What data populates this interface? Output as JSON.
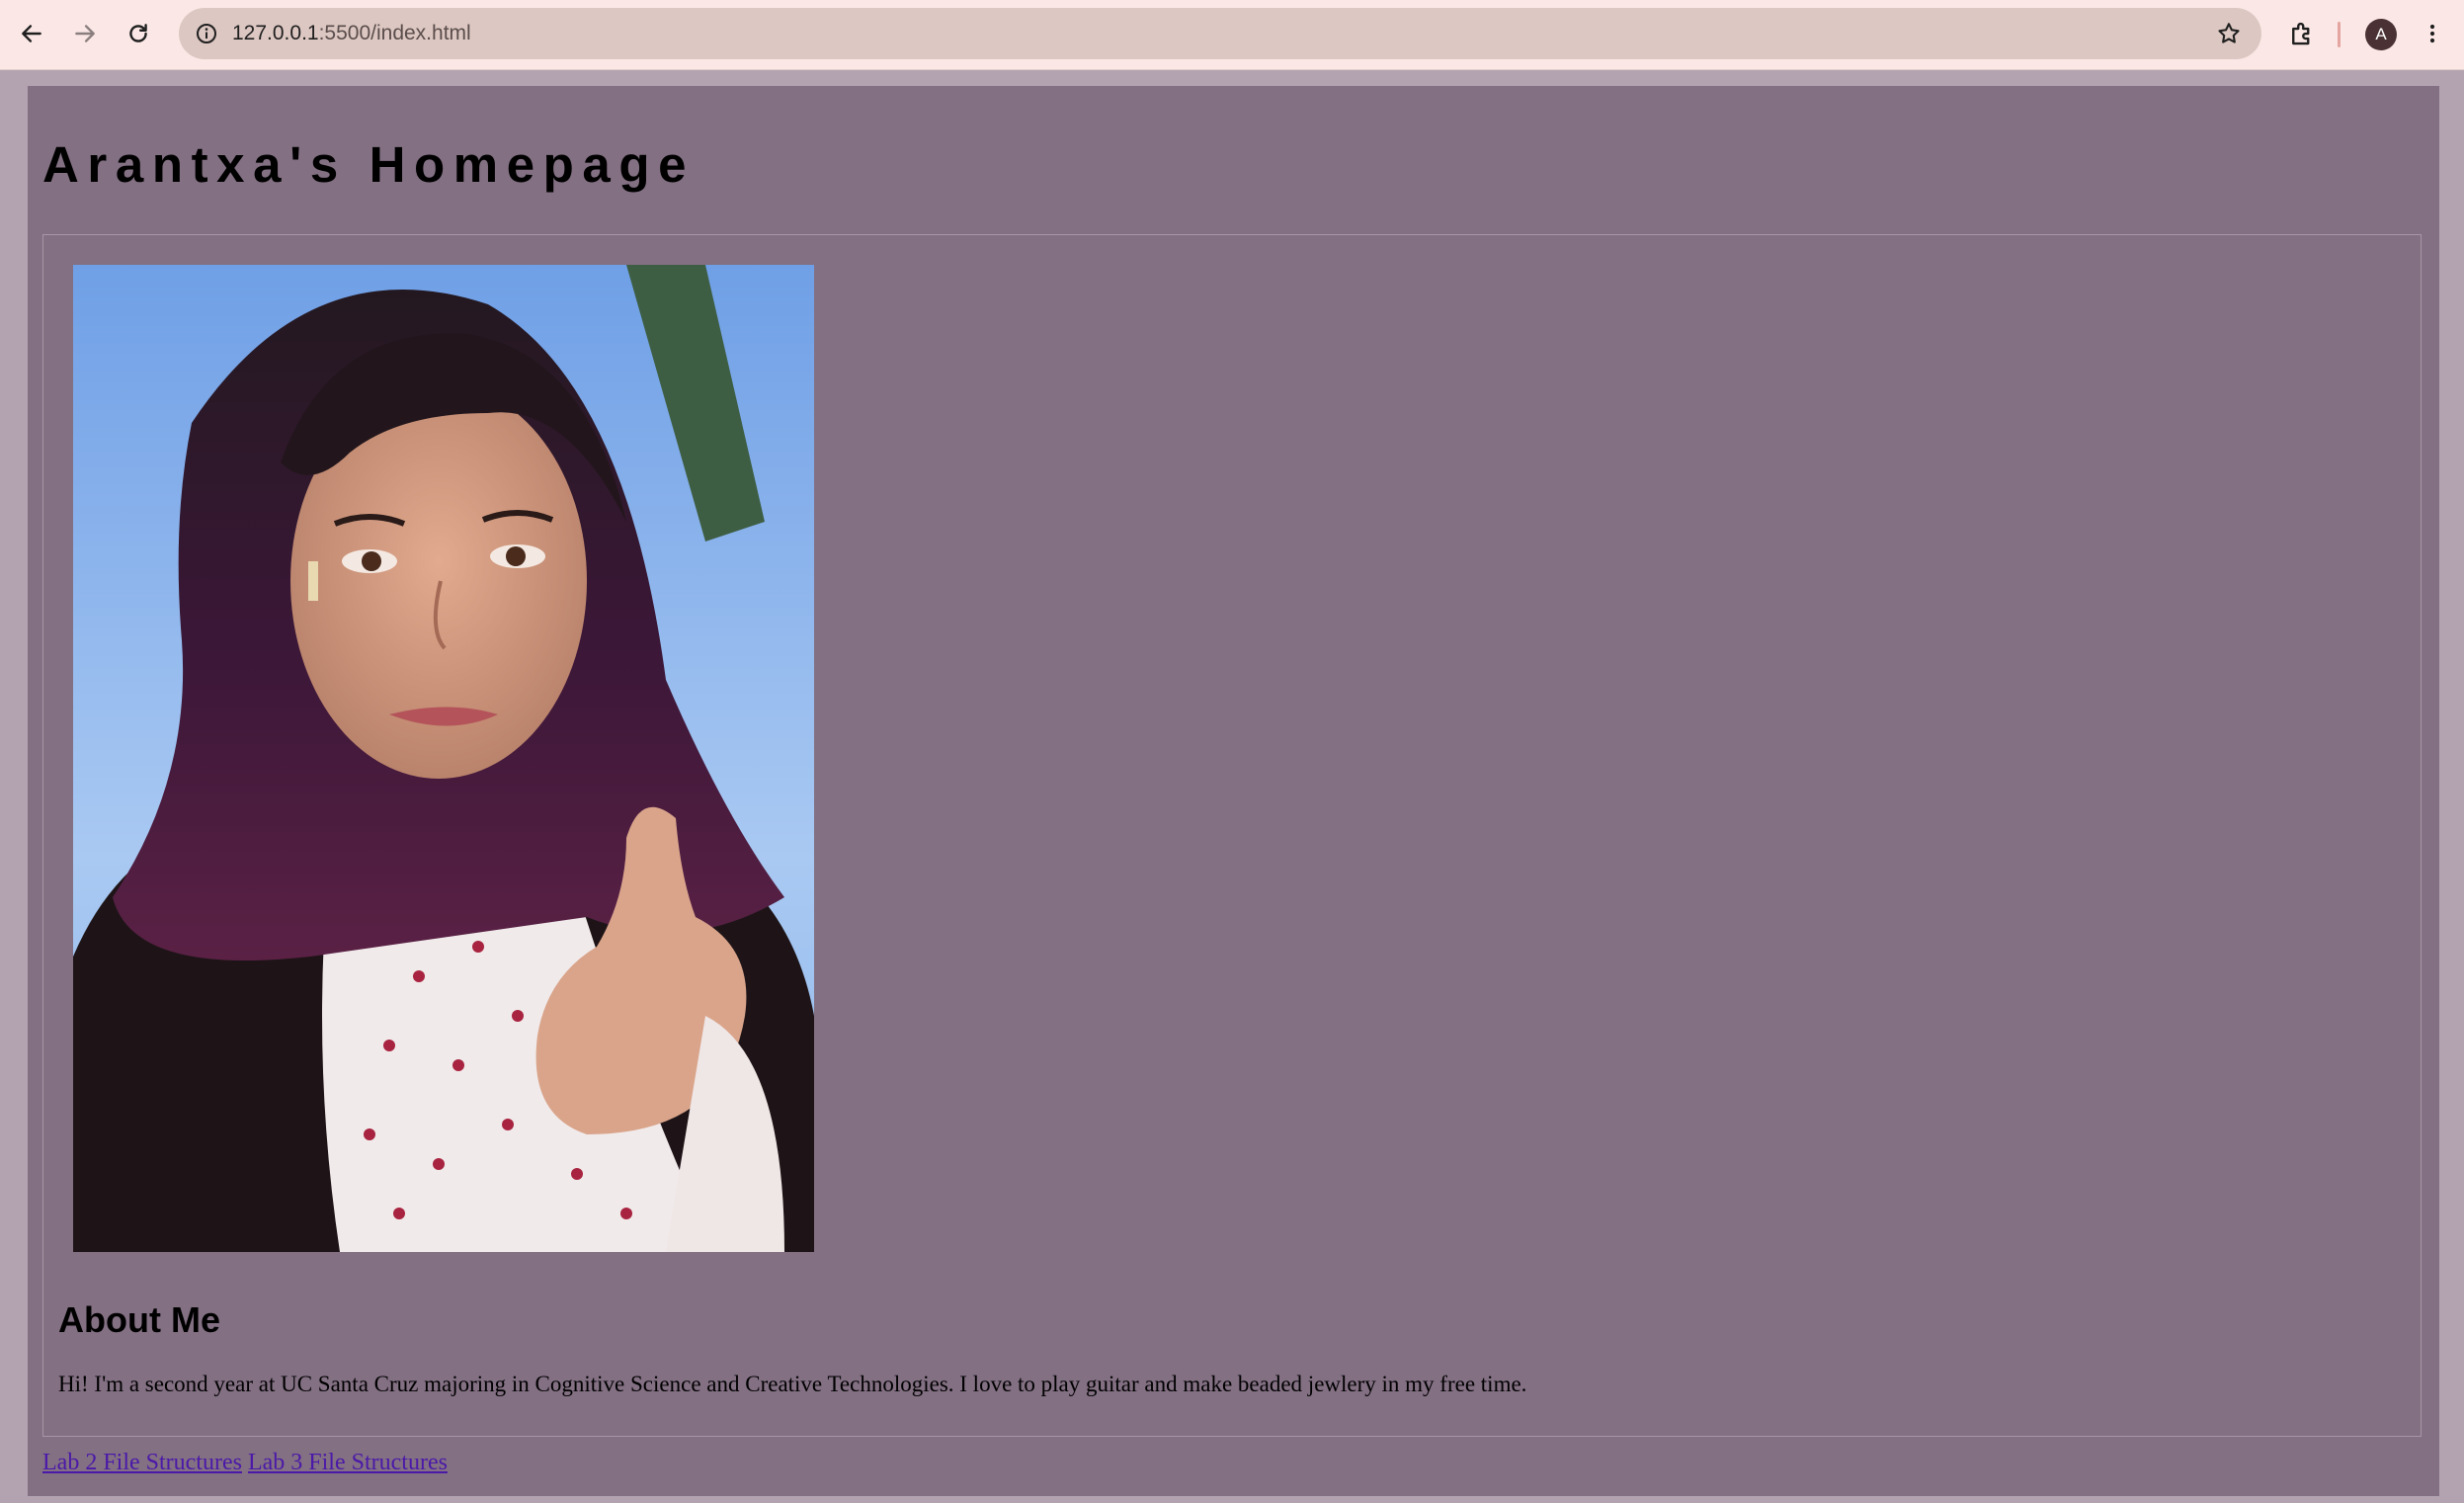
{
  "browser": {
    "url_host": "127.0.0.1",
    "url_path": ":5500/index.html",
    "profile_initial": "A",
    "icons": {
      "back": "back-arrow-icon",
      "forward": "forward-arrow-icon",
      "reload": "reload-icon",
      "site_info": "info-icon",
      "bookmark": "star-icon",
      "extensions": "puzzle-icon",
      "menu": "kebab-menu-icon"
    }
  },
  "page": {
    "title": "Arantxa's Homepage",
    "about": {
      "heading": "About Me",
      "text": "Hi! I'm a second year at UC Santa Cruz majoring in Cognitive Science and Creative Technologies. I love to play guitar and make beaded jewlery in my free time."
    },
    "links": [
      {
        "label": "Lab 2 File Structures"
      },
      {
        "label": "Lab 3 File Structures"
      }
    ],
    "colors": {
      "page_background": "#837083",
      "outer_background": "#b3a2b0",
      "link": "#4b19a8"
    }
  }
}
